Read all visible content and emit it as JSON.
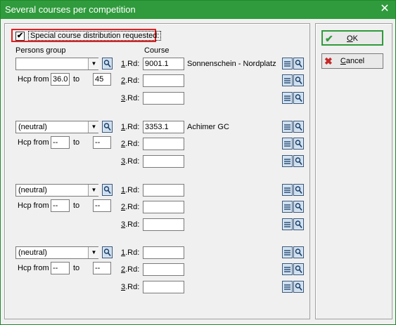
{
  "window": {
    "title": "Several courses per competition",
    "close_glyph": "✕"
  },
  "special": {
    "label": "Special course distribution requested:",
    "checked": true,
    "check_glyph": "✔"
  },
  "headers": {
    "persons_group": "Persons group",
    "course": "Course"
  },
  "hcp": {
    "from_label": "Hcp from",
    "to_label": "to"
  },
  "rounds": [
    {
      "num": "1",
      "suffix": ".Rd:"
    },
    {
      "num": "2",
      "suffix": ".Rd:"
    },
    {
      "num": "3",
      "suffix": ".Rd:"
    }
  ],
  "groups": [
    {
      "person_group": "",
      "hcp_from": "36.0",
      "hcp_to": "45",
      "courses": [
        {
          "value": "9001.1",
          "name": "Sonnenschein - Nordplatz"
        },
        {
          "value": "",
          "name": ""
        },
        {
          "value": "",
          "name": ""
        }
      ]
    },
    {
      "person_group": "(neutral)",
      "hcp_from": "--",
      "hcp_to": "--",
      "courses": [
        {
          "value": "3353.1",
          "name": "Achimer GC"
        },
        {
          "value": "",
          "name": ""
        },
        {
          "value": "",
          "name": ""
        }
      ]
    },
    {
      "person_group": "(neutral)",
      "hcp_from": "--",
      "hcp_to": "--",
      "courses": [
        {
          "value": "",
          "name": ""
        },
        {
          "value": "",
          "name": ""
        },
        {
          "value": "",
          "name": ""
        }
      ]
    },
    {
      "person_group": "(neutral)",
      "hcp_from": "--",
      "hcp_to": "--",
      "courses": [
        {
          "value": "",
          "name": ""
        },
        {
          "value": "",
          "name": ""
        },
        {
          "value": "",
          "name": ""
        }
      ]
    }
  ],
  "buttons": {
    "ok": {
      "mnemonic": "O",
      "rest": "K",
      "icon": "✔"
    },
    "cancel": {
      "mnemonic": "C",
      "rest": "ancel",
      "icon": "✖"
    }
  },
  "colors": {
    "title_bar": "#2f9b3c",
    "highlight": "#e81e1e",
    "ok_icon": "#2f9b3c",
    "cancel_icon": "#c62828"
  }
}
